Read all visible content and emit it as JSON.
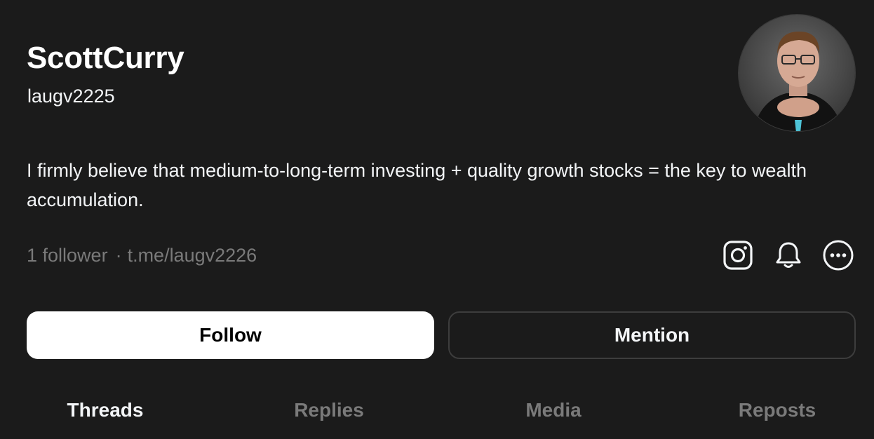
{
  "profile": {
    "display_name": "ScottCurry",
    "username": "laugv2225",
    "bio": "I firmly believe that medium-to-long-term investing + quality growth stocks = the key to wealth accumulation.",
    "followers_text": "1 follower",
    "separator": "·",
    "link": "t.me/laugv2226"
  },
  "icons": {
    "instagram": "instagram-icon",
    "notifications": "bell-icon",
    "more": "more-icon"
  },
  "actions": {
    "follow_label": "Follow",
    "mention_label": "Mention"
  },
  "tabs": [
    {
      "label": "Threads",
      "active": true
    },
    {
      "label": "Replies",
      "active": false
    },
    {
      "label": "Media",
      "active": false
    },
    {
      "label": "Reposts",
      "active": false
    }
  ],
  "colors": {
    "background": "#1b1b1b",
    "primary_text": "#f3f5f7",
    "secondary_text": "#7a7a7a",
    "follow_button_bg": "#ffffff",
    "outline": "#3d3d3d"
  }
}
